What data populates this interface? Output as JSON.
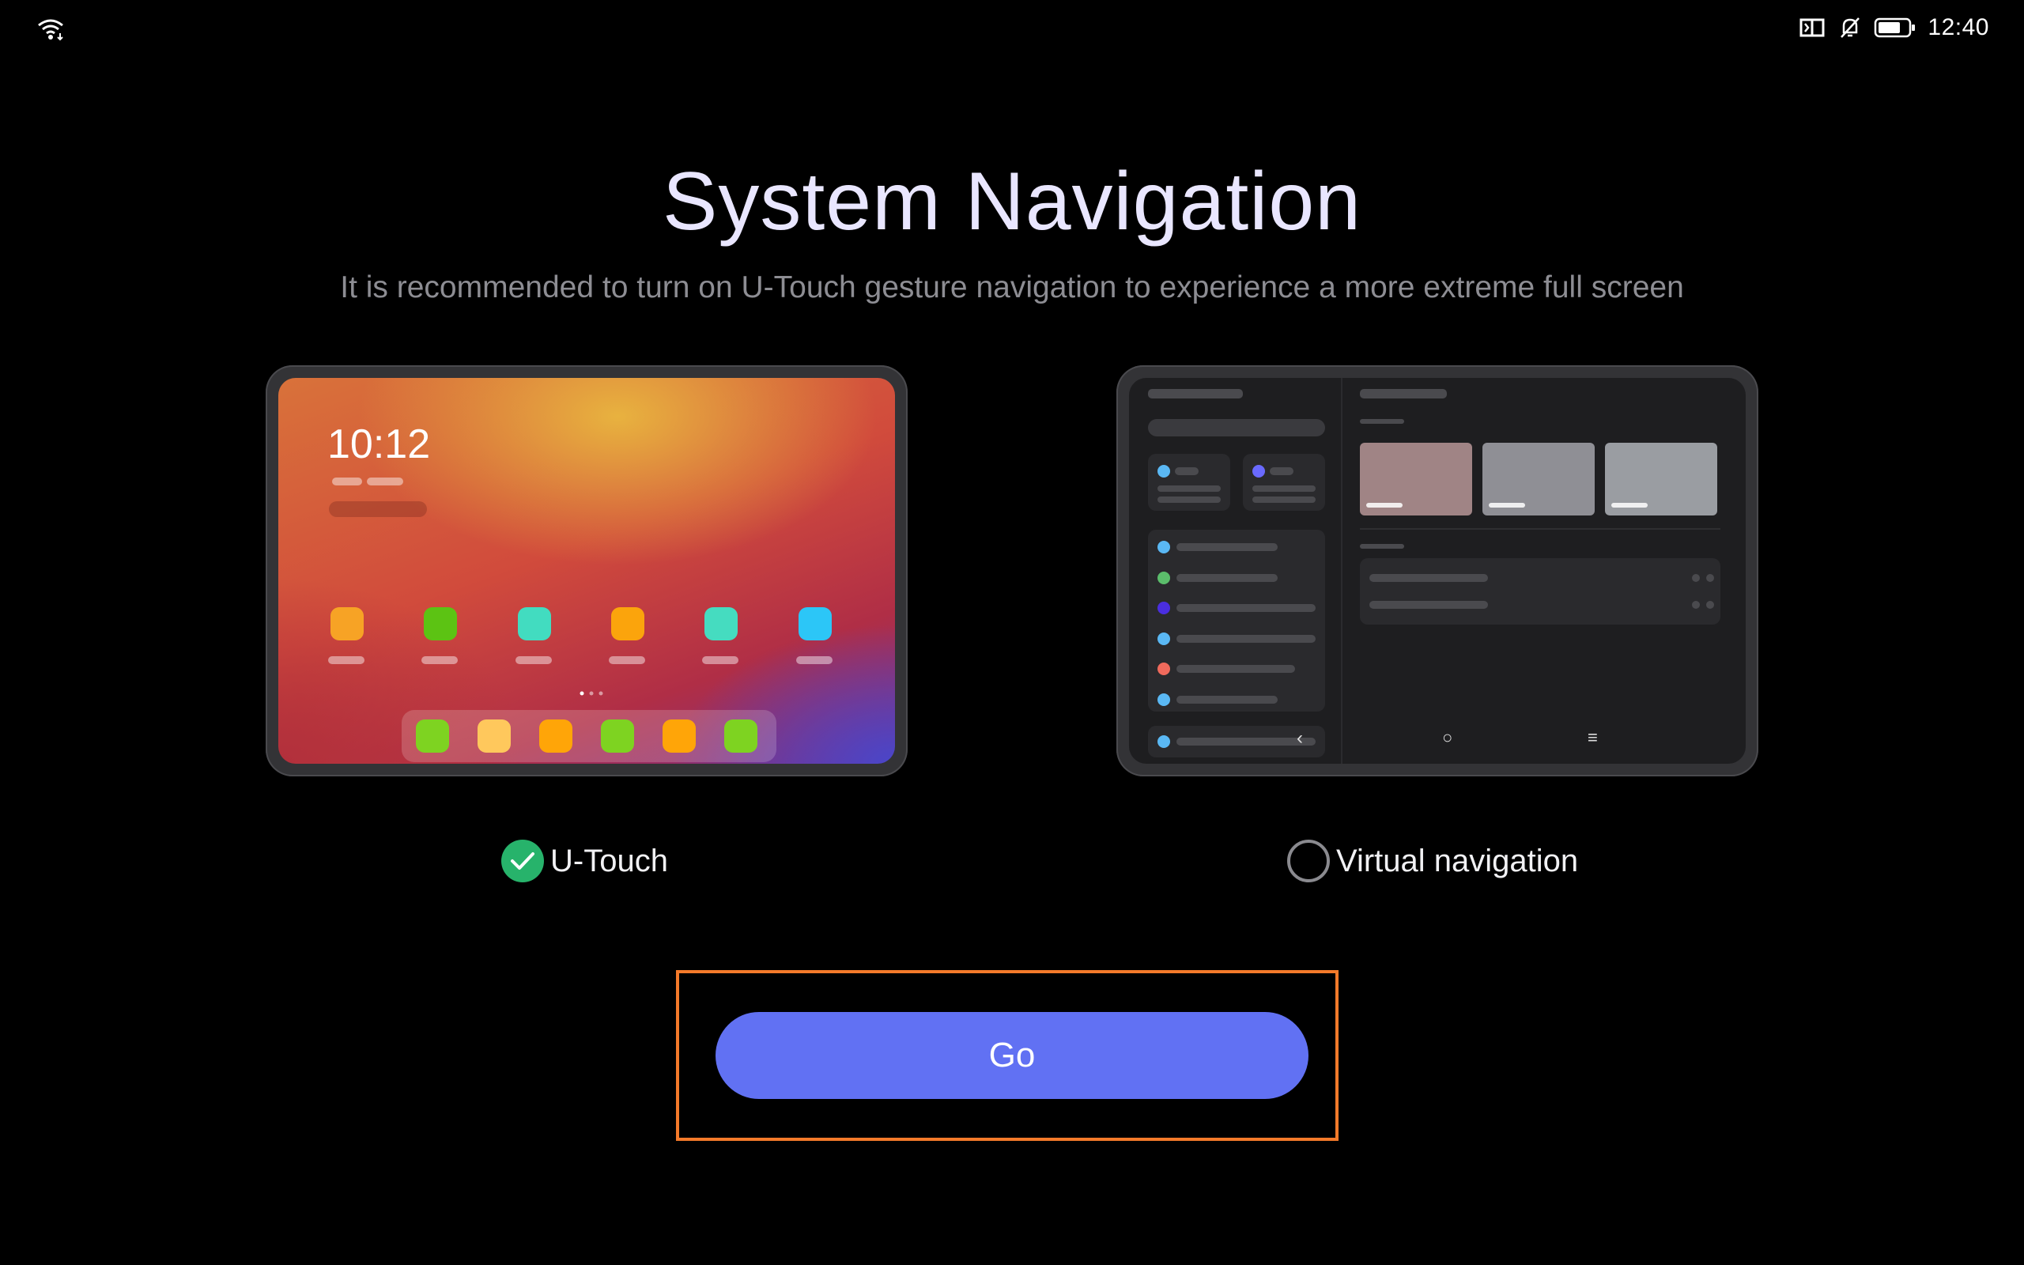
{
  "status_bar": {
    "time": "12:40",
    "icons": [
      "wifi-icon",
      "vibrate-icon",
      "silent-bell-icon",
      "battery-icon"
    ],
    "battery_level": 0.75
  },
  "header": {
    "title": "System Navigation",
    "subtitle": "It is recommended to turn on U-Touch gesture navigation to experience a more extreme full screen"
  },
  "preview_left": {
    "lock_time": "10:12",
    "app_colors": [
      "#f7a325",
      "#5cc313",
      "#42dcc0",
      "#fba40c",
      "#45dcc0",
      "#2cc6f7"
    ],
    "dock_colors": [
      "#7ed321",
      "#ffc85c",
      "#ffa508",
      "#7ed321",
      "#ffa508",
      "#7ed321"
    ]
  },
  "preview_right": {
    "list_dot_colors": [
      "#5ab8f4",
      "#5bbd6b",
      "#4a2ee0",
      "#5ab8f4",
      "#f06a5c",
      "#5ab8f4"
    ],
    "thumb_colors": [
      "#a08485",
      "#8f8f95",
      "#9a9da2"
    ],
    "nav_back": "‹",
    "nav_home": "○",
    "nav_menu": "≡"
  },
  "options": {
    "utouch": {
      "label": "U-Touch",
      "selected": true
    },
    "virtual": {
      "label": "Virtual navigation",
      "selected": false
    }
  },
  "actions": {
    "go_label": "Go"
  },
  "colors": {
    "accent": "#6171f3",
    "check": "#27b36b",
    "focus": "#f47a2a"
  }
}
